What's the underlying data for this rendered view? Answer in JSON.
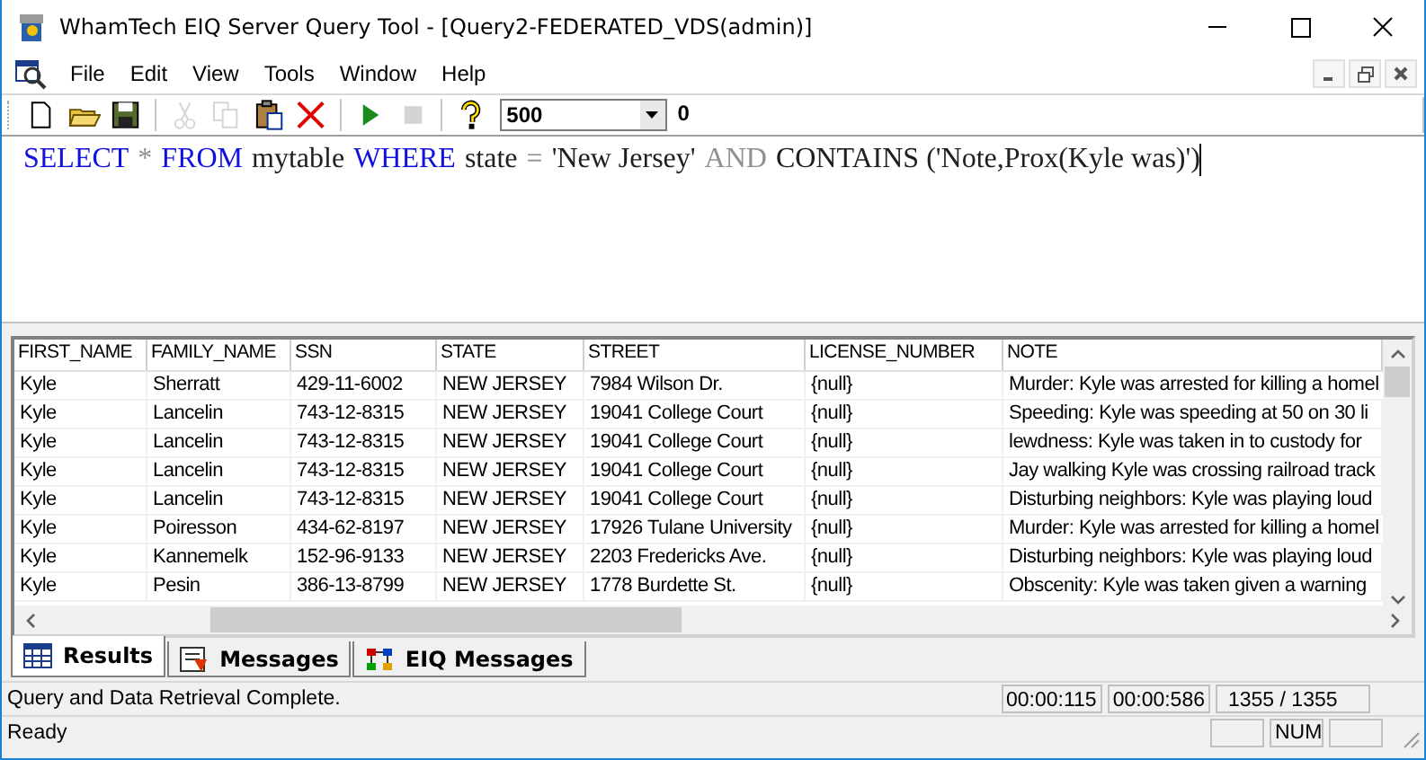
{
  "window": {
    "title": "WhamTech EIQ Server Query Tool - [Query2-FEDERATED_VDS(admin)]"
  },
  "menu": [
    "File",
    "Edit",
    "View",
    "Tools",
    "Window",
    "Help"
  ],
  "toolbar": [
    [
      {
        "kind": "new",
        "disabled": false
      },
      {
        "kind": "open",
        "disabled": false
      },
      {
        "kind": "save",
        "disabled": false
      }
    ],
    [
      {
        "kind": "cut",
        "disabled": true
      },
      {
        "kind": "copy",
        "disabled": true
      },
      {
        "kind": "paste",
        "disabled": false
      },
      {
        "kind": "delete",
        "disabled": false
      }
    ],
    [
      {
        "kind": "run",
        "disabled": false
      },
      {
        "kind": "stop",
        "disabled": true
      }
    ],
    [
      {
        "kind": "help",
        "disabled": false
      }
    ]
  ],
  "row_limit": "500",
  "counter": "0",
  "query": [
    {
      "kind": "keyword",
      "text": "SELECT"
    },
    {
      "kind": "operator",
      "text": "*"
    },
    {
      "kind": "keyword",
      "text": "FROM"
    },
    {
      "kind": "plain",
      "text": "mytable"
    },
    {
      "kind": "keyword",
      "text": "WHERE"
    },
    {
      "kind": "plain",
      "text": "state"
    },
    {
      "kind": "operator",
      "text": "="
    },
    {
      "kind": "plain",
      "text": "'New Jersey'"
    },
    {
      "kind": "operator",
      "text": "AND"
    },
    {
      "kind": "plain",
      "text": "CONTAINS ('Note,Prox(Kyle was)')"
    }
  ],
  "table": {
    "columns": [
      "FIRST_NAME",
      "FAMILY_NAME",
      "SSN",
      "STATE",
      "STREET",
      "LICENSE_NUMBER",
      "NOTE"
    ],
    "rows": [
      [
        "Kyle",
        "Sherratt",
        "429-11-6002",
        "NEW JERSEY",
        "7984 Wilson Dr.",
        "{null}",
        "Murder: Kyle was arrested for killing a homel"
      ],
      [
        "Kyle",
        "Lancelin",
        "743-12-8315",
        "NEW JERSEY",
        "19041 College Court",
        "{null}",
        "Speeding: Kyle was speeding at 50 on 30 li"
      ],
      [
        "Kyle",
        "Lancelin",
        "743-12-8315",
        "NEW JERSEY",
        "19041 College Court",
        "{null}",
        "lewdness: Kyle was taken in to custody for"
      ],
      [
        "Kyle",
        "Lancelin",
        "743-12-8315",
        "NEW JERSEY",
        "19041 College Court",
        "{null}",
        "Jay walking Kyle was crossing railroad track"
      ],
      [
        "Kyle",
        "Lancelin",
        "743-12-8315",
        "NEW JERSEY",
        "19041 College Court",
        "{null}",
        "Disturbing neighbors: Kyle was playing loud"
      ],
      [
        "Kyle",
        "Poiresson",
        "434-62-8197",
        "NEW JERSEY",
        "17926 Tulane University",
        "{null}",
        "Murder: Kyle was arrested for killing a homel"
      ],
      [
        "Kyle",
        "Kannemelk",
        "152-96-9133",
        "NEW JERSEY",
        "2203 Fredericks Ave.",
        "{null}",
        "Disturbing neighbors: Kyle was playing loud"
      ],
      [
        "Kyle",
        "Pesin",
        "386-13-8799",
        "NEW JERSEY",
        "1778 Burdette St.",
        "{null}",
        "Obscenity: Kyle was taken given a warning"
      ]
    ]
  },
  "tabs": [
    {
      "label": "Results",
      "kind": "grid",
      "selected": true
    },
    {
      "label": "Messages",
      "kind": "messages",
      "selected": false
    },
    {
      "label": "EIQ Messages",
      "kind": "eiq",
      "selected": false
    }
  ],
  "status_bar": {
    "message": "Query and Data Retrieval Complete.",
    "panels": [
      "00:00:115",
      "00:00:586",
      "1355 / 1355"
    ],
    "state": "Ready",
    "indicators": [
      "NUM"
    ]
  }
}
